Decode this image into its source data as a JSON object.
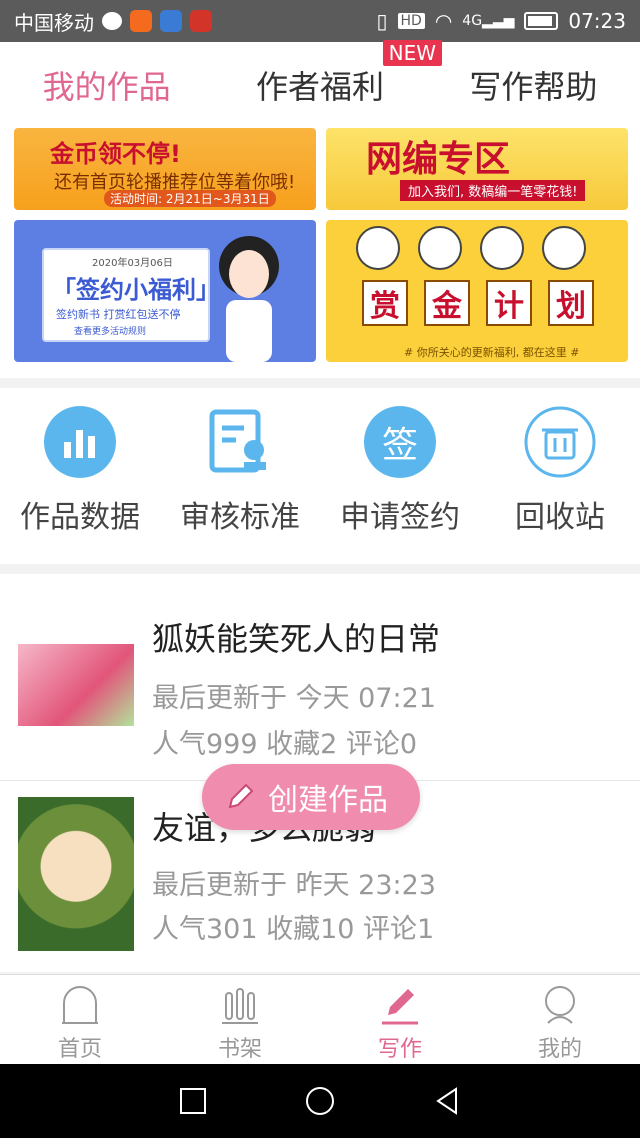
{
  "status_bar": {
    "carrier": "中国移动",
    "time": "07:23",
    "network": "4G",
    "hd": "HD"
  },
  "tabs": [
    {
      "label": "我的作品",
      "active": true
    },
    {
      "label": "作者福利",
      "badge": "NEW"
    },
    {
      "label": "写作帮助"
    }
  ],
  "banners": {
    "b1": {
      "headline": "金币领不停!",
      "line": "还有首页轮播推荐位等着你哦!",
      "period": "活动时间: 2月21日~3月31日"
    },
    "b2": {
      "headline": "网编专区",
      "sub": "加入我们, 数稿编一笔零花钱!"
    },
    "b3": {
      "date": "2020年03月06日",
      "title": "「签约小福利」",
      "sub": "签约新书  打赏红包送不停",
      "link": "查看更多活动规则"
    },
    "b4": {
      "chars": [
        "赏",
        "金",
        "计",
        "划"
      ],
      "foot": "# 你所关心的更新福利, 都在这里 #"
    }
  },
  "tools": [
    {
      "label": "作品数据",
      "icon": "bar-chart-icon"
    },
    {
      "label": "审核标准",
      "icon": "document-check-icon"
    },
    {
      "label": "申请签约",
      "icon": "sign-icon",
      "icon_text": "签"
    },
    {
      "label": "回收站",
      "icon": "trash-icon"
    }
  ],
  "works": [
    {
      "title": "狐妖能笑死人的日常",
      "updated": "最后更新于 今天 07:21",
      "stats": "人气999 收藏2 评论0"
    },
    {
      "title": "友谊，多么脆弱",
      "updated": "最后更新于 昨天 23:23",
      "stats": "人气301 收藏10 评论1"
    }
  ],
  "fab": {
    "label": "创建作品"
  },
  "bottom_nav": [
    {
      "label": "首页",
      "icon": "home-icon"
    },
    {
      "label": "书架",
      "icon": "bookshelf-icon"
    },
    {
      "label": "写作",
      "icon": "pen-icon",
      "active": true
    },
    {
      "label": "我的",
      "icon": "profile-icon"
    }
  ],
  "colors": {
    "accent": "#e0678f",
    "fab": "#f08cad",
    "badge": "#e8344e",
    "icon_blue": "#5ab6ec"
  }
}
